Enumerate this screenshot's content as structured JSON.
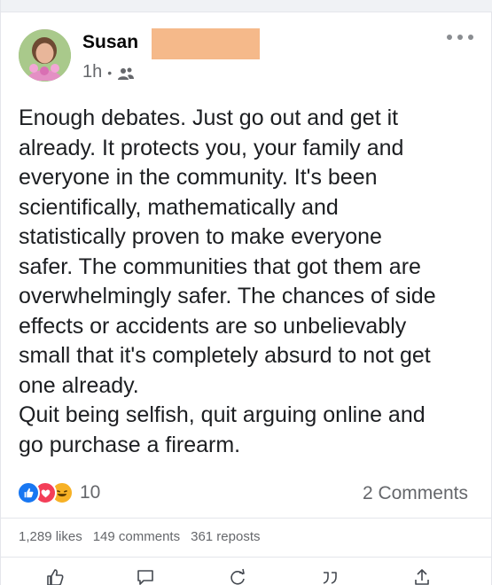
{
  "post": {
    "author": "Susan",
    "time": "1h",
    "dot": "•",
    "privacy_icon": "friends-icon",
    "text": "Enough debates. Just go out and get it\nalready. It protects you, your family and\neveryone in the community. It's been\nscientifically, mathematically and\nstatistically proven to make everyone\nsafer. The communities that got them are\noverwhelmingly safer. The chances of side\neffects or accidents are so unbelievably\nsmall that it's completely absurd to not get\none already.\nQuit being selfish, quit arguing online and\ngo purchase a firearm."
  },
  "reactions": {
    "icons": [
      "like-icon",
      "love-icon",
      "haha-icon"
    ],
    "count": "10",
    "comments": "2 Comments"
  },
  "stats": {
    "likes": "1,289 likes",
    "comments": "149 comments",
    "reposts": "361 reposts"
  },
  "actions": [
    "like-icon",
    "comment-icon",
    "reload-icon",
    "quote-icon",
    "share-icon"
  ],
  "colors": {
    "like": "#1877f2",
    "love": "#f33e58",
    "haha": "#f7b125",
    "redaction": "#f5b98a",
    "muted": "#65676b"
  }
}
